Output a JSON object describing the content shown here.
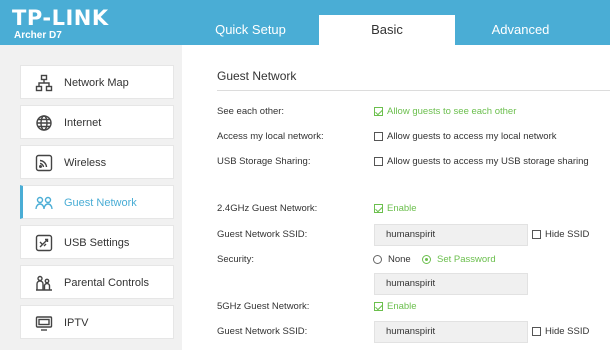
{
  "brand": {
    "logo": "TP-LINK",
    "model": "Archer D7"
  },
  "tabs": [
    {
      "label": "Quick Setup"
    },
    {
      "label": "Basic"
    },
    {
      "label": "Advanced"
    }
  ],
  "sidebar": {
    "items": [
      {
        "label": "Network Map",
        "icon": "network-map-icon"
      },
      {
        "label": "Internet",
        "icon": "globe-icon"
      },
      {
        "label": "Wireless",
        "icon": "wireless-icon"
      },
      {
        "label": "Guest Network",
        "icon": "guest-network-icon"
      },
      {
        "label": "USB Settings",
        "icon": "usb-icon"
      },
      {
        "label": "Parental Controls",
        "icon": "parental-controls-icon"
      },
      {
        "label": "IPTV",
        "icon": "tv-icon"
      }
    ]
  },
  "guest": {
    "title": "Guest Network",
    "see_each_other": {
      "label": "See each other:",
      "option": "Allow guests to see each other",
      "checked": true
    },
    "local_network": {
      "label": "Access my local network:",
      "option": "Allow guests to access my local network",
      "checked": false
    },
    "usb_sharing": {
      "label": "USB Storage Sharing:",
      "option": "Allow guests to access my USB storage sharing",
      "checked": false
    },
    "band24": {
      "label": "2.4GHz Guest Network:",
      "enable": "Enable",
      "enabled": true,
      "ssid_label": "Guest Network SSID:",
      "ssid": "humanspirit",
      "hide_ssid": "Hide SSID",
      "security_label": "Security:",
      "security_none": "None",
      "security_password": "Set Password",
      "password": "humanspirit"
    },
    "band5": {
      "label": "5GHz Guest Network:",
      "enable": "Enable",
      "enabled": true,
      "ssid_label": "Guest Network SSID:",
      "ssid": "humanspirit",
      "hide_ssid": "Hide SSID"
    }
  },
  "colors": {
    "accent": "#4aadd5",
    "check": "#6bbf4d"
  }
}
